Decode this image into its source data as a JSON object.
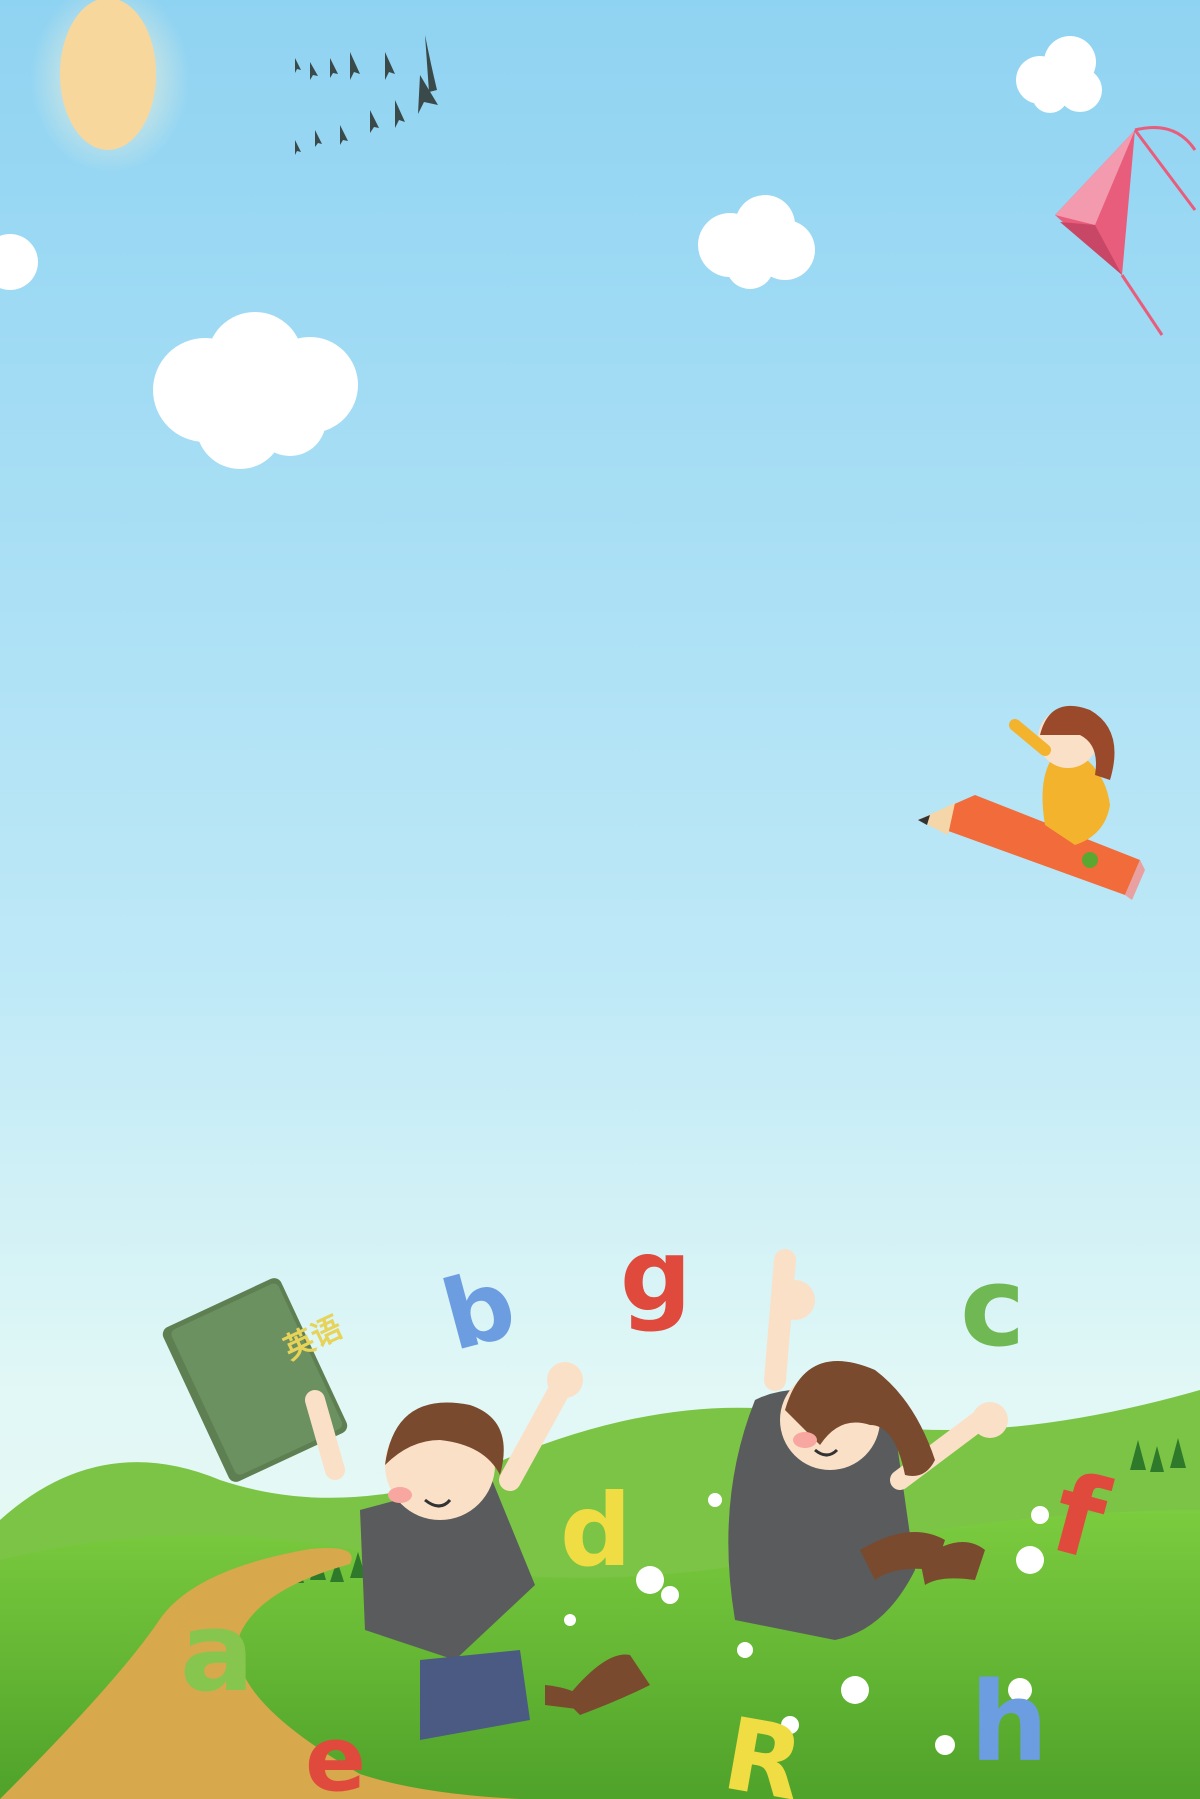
{
  "scene": {
    "sky_top_color": "#8fd3f2",
    "sky_mid_color": "#bfe9f7",
    "sky_bottom_color": "#dff6f7",
    "grass_color": "#63b62f",
    "hill_color": "#7cc446",
    "path_color": "#d8a84c",
    "sun_color": "#f8d79d",
    "kite_color": "#e85d7c",
    "pencil_color": "#f26b3a"
  },
  "book": {
    "title": "英语"
  },
  "letters": [
    "b",
    "g",
    "c",
    "d",
    "f",
    "a",
    "e",
    "R",
    "h"
  ]
}
